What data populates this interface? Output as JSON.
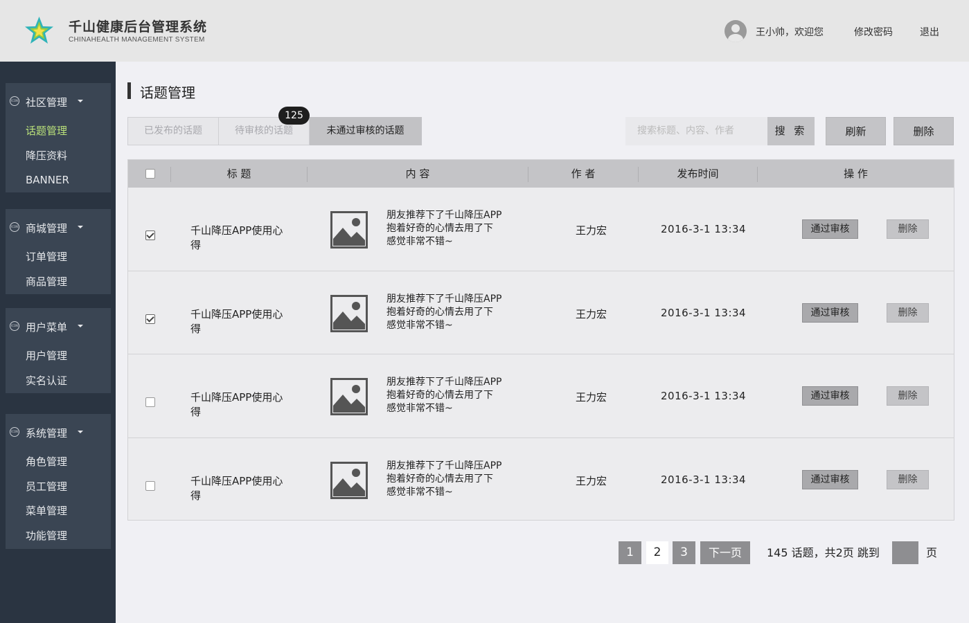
{
  "header": {
    "app_title": "千山健康后台管理系统",
    "app_subtitle": "CHINAHEALTH  MANAGEMENT SYSTEM",
    "welcome": "王小帅，欢迎您",
    "change_password": "修改密码",
    "logout": "退出"
  },
  "sidebar": {
    "icon_text": "ICON",
    "groups": [
      {
        "label": "社区管理",
        "items": [
          "话题管理",
          "降压资料",
          "BANNER"
        ]
      },
      {
        "label": "商城管理",
        "items": [
          "订单管理",
          "商品管理"
        ]
      },
      {
        "label": "用户菜单",
        "items": [
          "用户管理",
          "实名认证"
        ]
      },
      {
        "label": "系统管理",
        "items": [
          "角色管理",
          "员工管理",
          "菜单管理",
          "功能管理"
        ]
      }
    ],
    "active_item": "话题管理"
  },
  "main": {
    "page_title": "话题管理",
    "tabs": [
      {
        "label": "已发布的话题",
        "active": false
      },
      {
        "label": "待审核的话题",
        "active": false
      },
      {
        "label": "未通过审核的话题",
        "active": true
      }
    ],
    "pending_badge": "125",
    "search": {
      "placeholder": "搜索标题、内容、作者",
      "button": "搜 索"
    },
    "refresh": "刷新",
    "delete": "删除"
  },
  "table": {
    "columns": [
      "标 题",
      "内 容",
      "作 者",
      "发布时间",
      "操 作"
    ],
    "rows": [
      {
        "checked": true,
        "title": "千山降压APP使用心得",
        "content": [
          "朋友推荐下了千山降压APP",
          "抱着好奇的心情去用了下",
          "感觉非常不错~"
        ],
        "author": "王力宏",
        "time": "2016-3-1 13:34",
        "approve": "通过审核",
        "delete": "删除"
      },
      {
        "checked": true,
        "title": "千山降压APP使用心得",
        "content": [
          "朋友推荐下了千山降压APP",
          "抱着好奇的心情去用了下",
          "感觉非常不错~"
        ],
        "author": "王力宏",
        "time": "2016-3-1 13:34",
        "approve": "通过审核",
        "delete": "删除"
      },
      {
        "checked": false,
        "title": "千山降压APP使用心得",
        "content": [
          "朋友推荐下了千山降压APP",
          "抱着好奇的心情去用了下",
          "感觉非常不错~"
        ],
        "author": "王力宏",
        "time": "2016-3-1 13:34",
        "approve": "通过审核",
        "delete": "删除"
      },
      {
        "checked": false,
        "title": "千山降压APP使用心得",
        "content": [
          "朋友推荐下了千山降压APP",
          "抱着好奇的心情去用了下",
          "感觉非常不错~"
        ],
        "author": "王力宏",
        "time": "2016-3-1 13:34",
        "approve": "通过审核",
        "delete": "删除"
      }
    ]
  },
  "pagination": {
    "pages": [
      "1",
      "2",
      "3"
    ],
    "current_page": "2",
    "next": "下一页",
    "summary": "145 话题，共2页  跳到",
    "unit": "页"
  },
  "colors": {
    "header_bg": "#e6e6e6",
    "sidebar_bg": "#2a3441",
    "menu_group_bg": "#3a4553",
    "active_menu_text": "#b9e07a",
    "logo_teal": "#2fb3b8",
    "logo_green": "#9ccc3c"
  }
}
